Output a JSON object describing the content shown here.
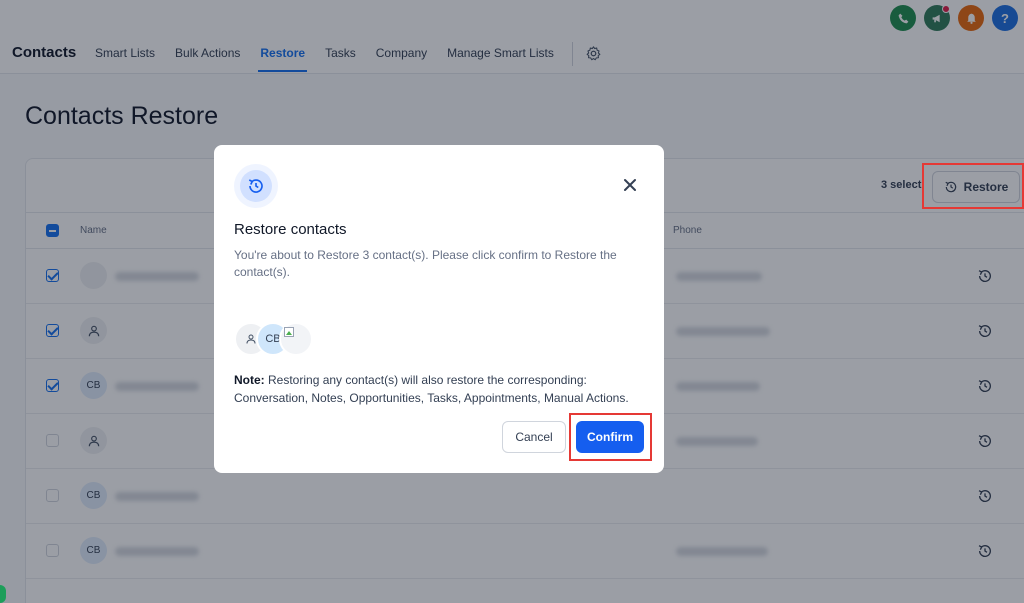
{
  "header": {
    "brand": "Contacts",
    "nav": [
      "Smart Lists",
      "Bulk Actions",
      "Restore",
      "Tasks",
      "Company",
      "Manage Smart Lists"
    ],
    "active_nav": "Restore",
    "top_icons": [
      {
        "name": "phone-icon",
        "color": "#1e8e4e"
      },
      {
        "name": "megaphone-icon",
        "color": "#2f7a58"
      },
      {
        "name": "bell-icon",
        "color": "#e8680c"
      },
      {
        "name": "help-icon",
        "glyph": "?",
        "color": "#1d6fe0"
      }
    ]
  },
  "page": {
    "title": "Contacts Restore"
  },
  "toolbar": {
    "selected_text": "3 select",
    "restore_label": "Restore"
  },
  "table": {
    "headers": {
      "name": "Name",
      "phone": "Phone"
    },
    "rows": [
      {
        "checked": true,
        "avatar": "image"
      },
      {
        "checked": true,
        "avatar": "person"
      },
      {
        "checked": true,
        "avatar": "CB"
      },
      {
        "checked": false,
        "avatar": "person"
      },
      {
        "checked": false,
        "avatar": "CB"
      },
      {
        "checked": false,
        "avatar": "CB"
      }
    ]
  },
  "modal": {
    "title": "Restore contacts",
    "description": "You're about to Restore 3 contact(s). Please click confirm to Restore the contact(s).",
    "stack_initials": "CB",
    "note_label": "Note:",
    "note_text": " Restoring any contact(s) will also restore the corresponding: Conversation, Notes, Opportunities, Tasks, Appointments, Manual Actions.",
    "cancel_label": "Cancel",
    "confirm_label": "Confirm"
  },
  "colors": {
    "accent": "#155eef",
    "highlight": "#e53935"
  }
}
